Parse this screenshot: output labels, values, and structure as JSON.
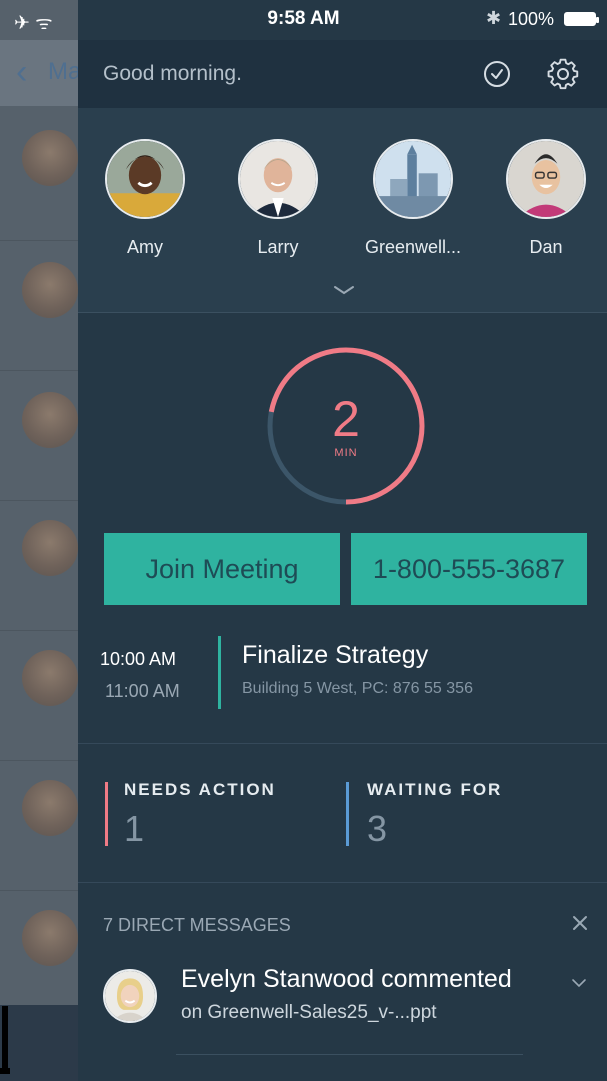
{
  "status_bar": {
    "signal": "✈ ᯤ",
    "time": "9:58 AM",
    "bluetooth": "✱",
    "battery": "100%"
  },
  "background_app": {
    "back_label": "Ma"
  },
  "header": {
    "greeting": "Good morning."
  },
  "favorites": [
    {
      "name": "Amy"
    },
    {
      "name": "Larry"
    },
    {
      "name": "Greenwell..."
    },
    {
      "name": "Dan"
    }
  ],
  "timer": {
    "number": "2",
    "unit": "MIN",
    "progress": 0.72
  },
  "actions": {
    "join_label": "Join Meeting",
    "dial_label": "1-800-555-3687"
  },
  "meeting": {
    "start": "10:00 AM",
    "end": "11:00 AM",
    "title": "Finalize Strategy",
    "location": "Building 5 West, PC: 876  55  356"
  },
  "tasks": {
    "needs_action_label": "NEEDS ACTION",
    "needs_action_count": "1",
    "waiting_for_label": "WAITING FOR",
    "waiting_for_count": "3"
  },
  "messages": {
    "header": "7 DIRECT MESSAGES",
    "item_title": "Evelyn Stanwood commented",
    "item_subtitle": "on Greenwell-Sales25_v-...ppt"
  },
  "colors": {
    "panel": "#253846",
    "accent_teal": "#2fb3a0",
    "accent_pink": "#f07b86",
    "accent_blue": "#5b9bd5"
  }
}
